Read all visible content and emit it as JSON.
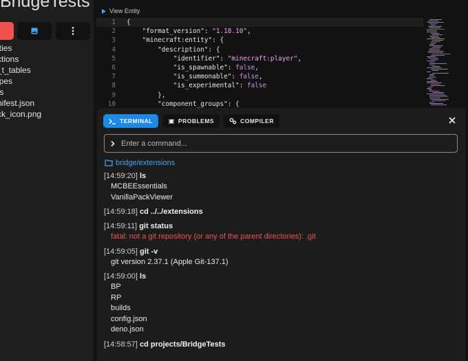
{
  "sidebar": {
    "project_title": "BridgeTests",
    "files": [
      "ities",
      "ctions",
      "_t_tables",
      "ipes",
      "ts",
      "nifest.json",
      "ck_icon.png"
    ]
  },
  "editor": {
    "breadcrumb": "View Entity",
    "lines": [
      {
        "n": "1",
        "text": "{"
      },
      {
        "n": "2",
        "key": "\"format_version\"",
        "sep": ": ",
        "val": "\"1.18.10\"",
        "end": ","
      },
      {
        "n": "3",
        "key": "\"minecraft:entity\"",
        "sep": ": ",
        "end": "{"
      },
      {
        "n": "4",
        "key": "\"description\"",
        "sep": ": ",
        "end": "{"
      },
      {
        "n": "5",
        "key": "\"identifier\"",
        "sep": ": ",
        "val": "\"minecraft:player\"",
        "end": ","
      },
      {
        "n": "6",
        "key": "\"is_spawnable\"",
        "sep": ": ",
        "bool": "false",
        "end": ","
      },
      {
        "n": "7",
        "key": "\"is_summonable\"",
        "sep": ": ",
        "bool": "false",
        "end": ","
      },
      {
        "n": "8",
        "key": "\"is_experimental\"",
        "sep": ": ",
        "bool": "false"
      },
      {
        "n": "9",
        "text": "},"
      },
      {
        "n": "10",
        "text": "\"component_groups\": {"
      }
    ]
  },
  "panel": {
    "tabs": [
      {
        "label": "TERMINAL",
        "icon": "terminal-icon",
        "active": true
      },
      {
        "label": "PROBLEMS",
        "icon": "bug-icon",
        "active": false
      },
      {
        "label": "COMPILER",
        "icon": "cogs-icon",
        "active": false
      }
    ],
    "command_placeholder": "Enter a command...",
    "cwd": "bridge/extensions",
    "log": [
      {
        "time": "[14:59:20]",
        "cmd": "ls",
        "output": [
          "MCBEEssentials",
          "VanillaPackViewer"
        ],
        "error": false
      },
      {
        "time": "[14:59:18]",
        "cmd": "cd ../../extensions",
        "output": [],
        "error": false
      },
      {
        "time": "[14:59:11]",
        "cmd": "git status",
        "output": [
          "fatal: not a git repository (or any of the parent directories): .git"
        ],
        "error": true
      },
      {
        "time": "[14:59:05]",
        "cmd": "git -v",
        "output": [
          "git version 2.37.1 (Apple Git-137.1)"
        ],
        "error": false
      },
      {
        "time": "[14:59:00]",
        "cmd": "ls",
        "output": [
          "BP",
          "RP",
          "builds",
          "config.json",
          "deno.json"
        ],
        "error": false
      },
      {
        "time": "[14:58:57]",
        "cmd": "cd projects/BridgeTests",
        "output": [],
        "error": false
      }
    ]
  },
  "colors": {
    "accent": "#1e88e5",
    "error": "#ef5350",
    "string": "#f5a3f5",
    "boolean": "#c792ea"
  }
}
